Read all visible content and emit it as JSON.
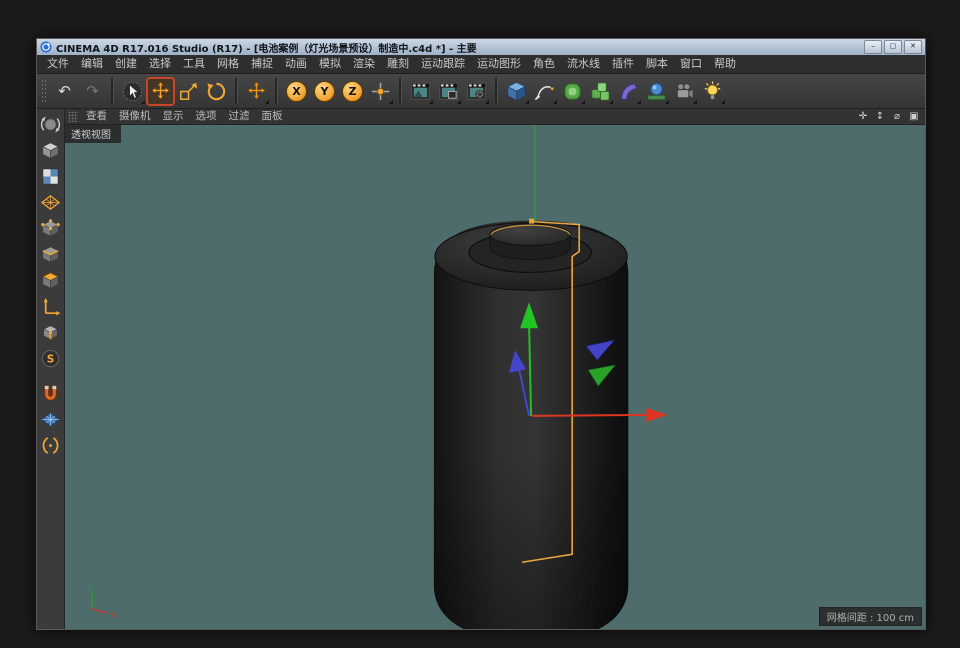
{
  "window": {
    "title": "CINEMA 4D R17.016 Studio (R17) - [电池案例（灯光场景预设）制造中.c4d *] - 主要",
    "controls": {
      "minimize": "–",
      "maximize": "▢",
      "close": "✕"
    }
  },
  "menu_bar": {
    "items": [
      "文件",
      "编辑",
      "创建",
      "选择",
      "工具",
      "网格",
      "捕捉",
      "动画",
      "模拟",
      "渲染",
      "雕刻",
      "运动跟踪",
      "运动图形",
      "角色",
      "流水线",
      "插件",
      "脚本",
      "窗口",
      "帮助"
    ]
  },
  "toolbar": {
    "undo_glyph": "↶",
    "redo_glyph": "↷",
    "axis_locks": {
      "x": "X",
      "y": "Y",
      "z": "Z"
    }
  },
  "sidebar": {
    "s_glyph": "S"
  },
  "viewport": {
    "menus": [
      "查看",
      "摄像机",
      "显示",
      "选项",
      "过滤",
      "面板"
    ],
    "view_label": "透视视图",
    "grid_spacing": "网格间距 : 100 cm",
    "nav_icons": [
      {
        "name": "pan-view-icon",
        "glyph": "✛"
      },
      {
        "name": "dolly-view-icon",
        "glyph": "↕"
      },
      {
        "name": "rotate-view-icon",
        "glyph": "⌀"
      },
      {
        "name": "toggle-view-icon",
        "glyph": "▣"
      }
    ],
    "axis_labels": {
      "x": "x",
      "y": "y"
    }
  },
  "colors": {
    "viewport_bg": "#4e6c6c",
    "accent_orange": "#f0a030",
    "axis_red": "#de3424",
    "axis_green": "#28bd28",
    "axis_blue": "#4646cc",
    "spline_orange": "#e9a63c"
  }
}
